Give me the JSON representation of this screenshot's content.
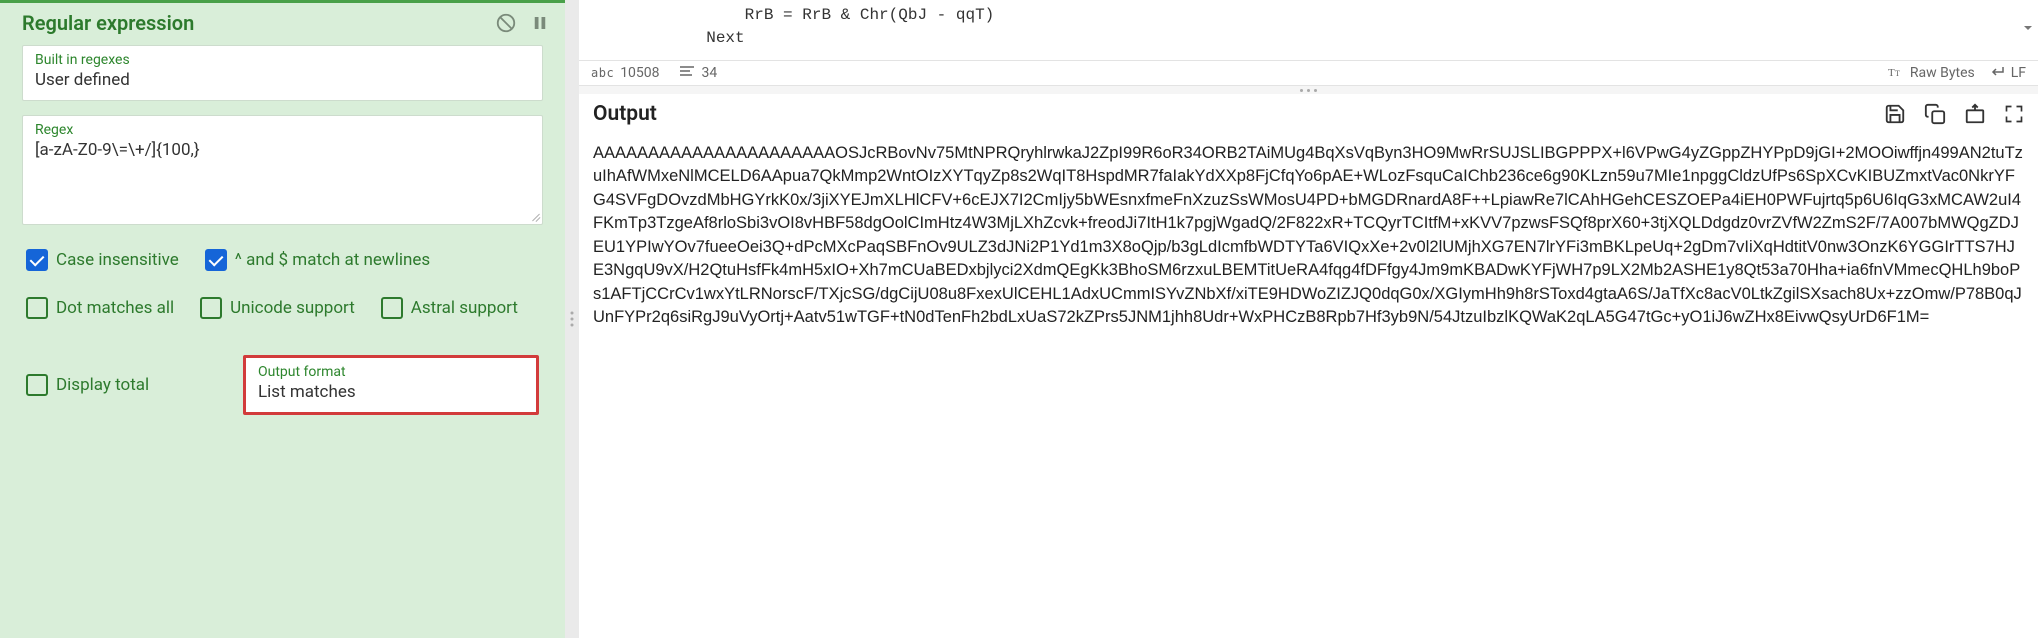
{
  "panel": {
    "title": "Regular expression",
    "builtin_label": "Built in regexes",
    "builtin_value": "User defined",
    "regex_label": "Regex",
    "regex_value": "[a-zA-Z0-9\\=\\+/]{100,}",
    "case_insensitive": "Case insensitive",
    "newlines": "^ and $ match at newlines",
    "dot_matches": "Dot matches all",
    "unicode": "Unicode support",
    "astral": "Astral support",
    "display_total": "Display total",
    "output_format_label": "Output format",
    "output_format_value": "List matches"
  },
  "code": {
    "line1": "                RrB = RrB & Chr(QbJ - qqT)",
    "line2": "            Next"
  },
  "status": {
    "abc": "abc",
    "count1": "10508",
    "count2": "34",
    "raw_bytes": "Raw Bytes",
    "lf": "LF"
  },
  "output": {
    "title": "Output",
    "text": "AAAAAAAAAAAAAAAAAAAAAAOSJcRBovNv75MtNPRQryhlrwkaJ2ZpI99R6oR34ORB2TAiMUg4BqXsVqByn3HO9MwRrSUJSLIBGPPPX+l6VPwG4yZGppZHYPpD9jGI+2MOOiwffjn499AN2tuTzuIhAfWMxeNlMCELD6AApua7QkMmp2WntOIzXYTqyZp8s2WqIT8HspdMR7faIakYdXXp8FjCfqYo6pAE+WLozFsquCaIChb236ce6g90KLzn59u7MIe1npggCldzUfPs6SpXCvKIBUZmxtVac0NkrYFG4SVFgDOvzdMbHGYrkK0x/3jiXYEJmXLHlCFV+6cEJX7I2CmIjy5bWEsnxfmeFnXzuzSsWMosU4PD+bMGDRnardA8F++LpiawRe7lCAhHGehCESZOEPa4iEH0PWFujrtq5p6U6IqG3xMCAW2uI4FKmTp3TzgeAf8rloSbi3vOI8vHBF58dgOolCImHtz4W3MjLXhZcvk+freodJi7ItH1k7pgjWgadQ/2F822xR+TCQyrTCItfM+xKVV7pzwsFSQf8prX60+3tjXQLDdgdz0vrZVfW2ZmS2F/7A007bMWQgZDJEU1YPIwYOv7fueeOei3Q+dPcMXcPaqSBFnOv9ULZ3dJNi2P1Yd1m3X8oQjp/b3gLdIcmfbWDTYTa6VIQxXe+2v0l2lUMjhXG7EN7lrYFi3mBKLpeUq+2gDm7vIiXqHdtitV0nw3OnzK6YGGIrTTS7HJE3NgqU9vX/H2QtuHsfFk4mH5xIO+Xh7mCUaBEDxbjlyci2XdmQEgKk3BhoSM6rzxuLBEMTitUeRA4fqg4fDFfgy4Jm9mKBADwKYFjWH7p9LX2Mb2ASHE1y8Qt53a70Hha+ia6fnVMmecQHLh9boPs1AFTjCCrCv1wxYtLRNorscF/TXjcSG/dgCijU08u8FxexUlCEHL1AdxUCmmISYvZNbXf/xiTE9HDWoZIZJQ0dqG0x/XGIymHh9h8rSToxd4gtaA6S/JaTfXc8acV0LtkZgilSXsach8Ux+zzOmw/P78B0qJUnFYPr2q6siRgJ9uVyOrtj+Aatv51wTGF+tN0dTenFh2bdLxUaS72kZPrs5JNM1jhh8Udr+WxPHCzB8Rpb7Hf3yb9N/54JtzuIbzlKQWaK2qLA5G47tGc+yO1iJ6wZHx8EivwQsyUrD6F1M="
  }
}
